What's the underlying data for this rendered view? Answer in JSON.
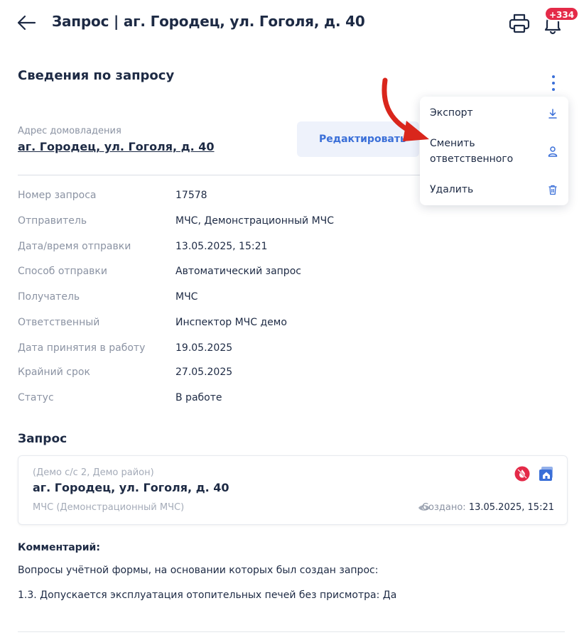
{
  "header": {
    "title": "Запрос |  аг. Городец, ул. Гоголя, д. 40",
    "notification_count": "+334"
  },
  "section": {
    "title": "Сведения по запросу"
  },
  "address": {
    "label": "Адрес домовладения",
    "value": "аг. Городец, ул. Гоголя, д. 40",
    "edit_label": "Редактировать"
  },
  "menu": {
    "items": [
      {
        "label": "Экспорт",
        "icon": "download-icon"
      },
      {
        "label": "Сменить\nответственного",
        "icon": "user-icon"
      },
      {
        "label": "Удалить",
        "icon": "trash-icon"
      }
    ]
  },
  "details": [
    {
      "key": "Номер запроса",
      "value": "17578"
    },
    {
      "key": "Отправитель",
      "value": "МЧС, Демонстрационный МЧС"
    },
    {
      "key": "Дата/время отправки",
      "value": "13.05.2025, 15:21"
    },
    {
      "key": "Способ отправки",
      "value": "Автоматический запрос"
    },
    {
      "key": "Получатель",
      "value": "МЧС"
    },
    {
      "key": "Ответственный",
      "value": "Инспектор МЧС демо"
    },
    {
      "key": "Дата принятия в работу",
      "value": "19.05.2025"
    },
    {
      "key": "Крайний срок",
      "value": "27.05.2025"
    },
    {
      "key": "Статус",
      "value": "В работе"
    }
  ],
  "request": {
    "title": "Запрос",
    "district": "(Демо с/с 2, Демо район)",
    "address": "аг. Городец, ул. Гоголя, д. 40",
    "sender": "МЧС (Демонстрационный МЧС)",
    "created_label": "Создано:",
    "created_value": "13.05.2025, 15:21"
  },
  "comment": {
    "title": "Комментарий:",
    "lines": [
      "Вопросы учётной формы, на основании которых был создан запрос:",
      "1.3. Допускается эксплуатация отопительных печей без присмотра: Да"
    ]
  },
  "colors": {
    "accent": "#3a6fd8",
    "badge": "#e42a48",
    "annotation_arrow": "#d9261c"
  }
}
